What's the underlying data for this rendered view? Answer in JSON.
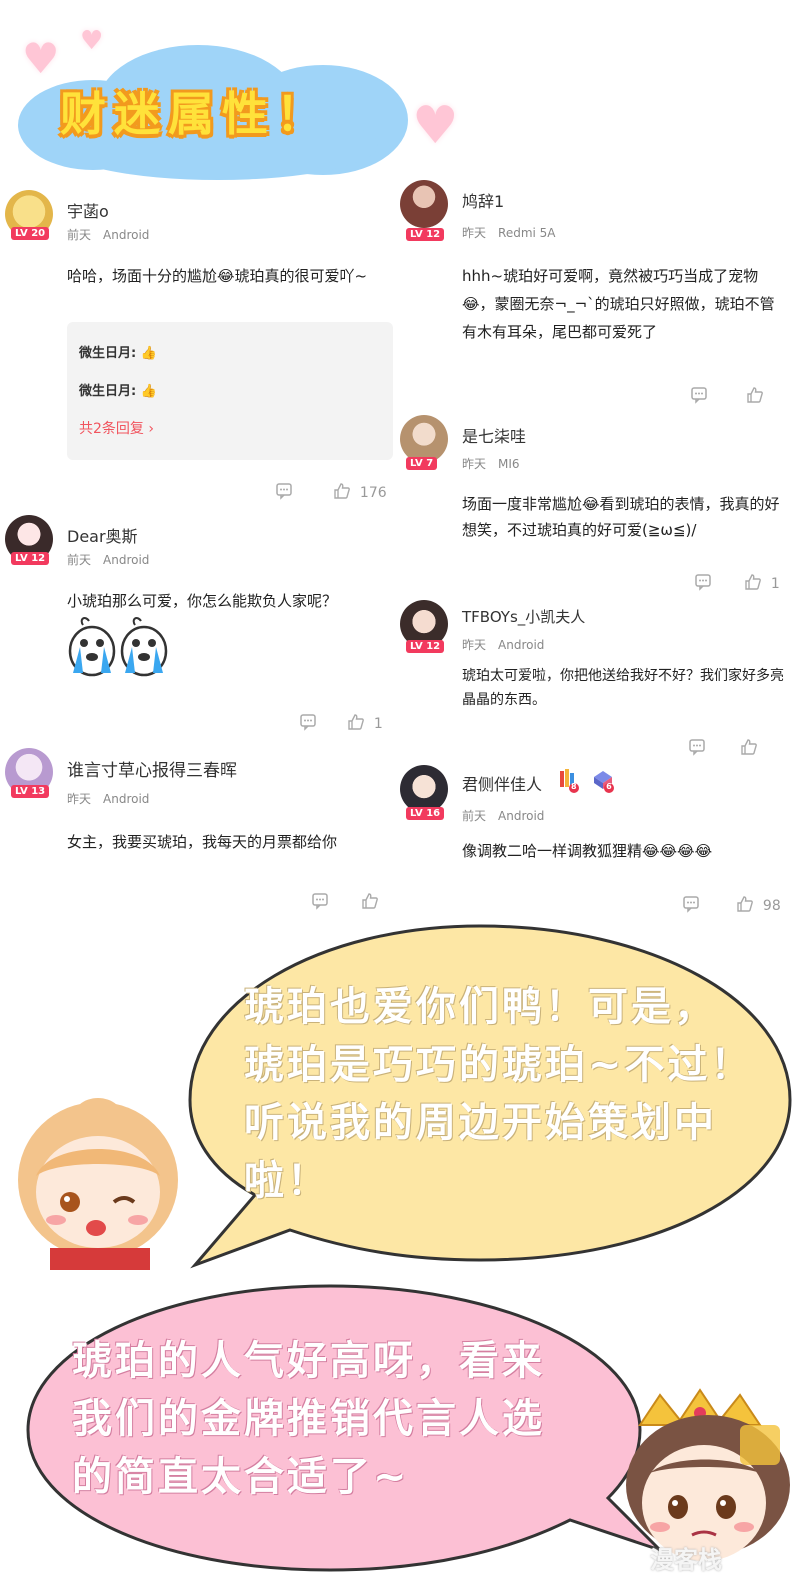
{
  "banner": {
    "title": "财迷属性！"
  },
  "comments_left": [
    {
      "level": "LV 20",
      "name": "宇菡o",
      "time": "前天",
      "device": "Android",
      "text": "哈哈，场面十分的尴尬😂琥珀真的很可爱吖~",
      "replies": [
        "微生日月:",
        "微生日月:"
      ],
      "reply_more": "共2条回复",
      "likes": "176"
    },
    {
      "level": "LV 12",
      "name": "Dear奥斯",
      "time": "前天",
      "device": "Android",
      "text": "小琥珀那么可爱，你怎么能欺负人家呢？",
      "likes": "1"
    },
    {
      "level": "LV 13",
      "name": "谁言寸草心报得三春晖",
      "time": "昨天",
      "device": "Android",
      "text": "女主，我要买琥珀，我每天的月票都给你",
      "likes": ""
    }
  ],
  "comments_right": [
    {
      "level": "LV 12",
      "name": "鸠辞1",
      "time": "昨天",
      "device": "Redmi 5A",
      "text": "hhh~琥珀好可爱啊，竟然被巧巧当成了宠物😂，蒙圈无奈¬_¬`的琥珀只好照做，琥珀不管有木有耳朵，尾巴都可爱死了",
      "likes": ""
    },
    {
      "level": "LV 7",
      "name": "是七柒哇",
      "time": "昨天",
      "device": "MI6",
      "text": "场面一度非常尴尬😂看到琥珀的表情，我真的好想笑，不过琥珀真的好可爱(≧ω≦)/",
      "likes": "1"
    },
    {
      "level": "LV 12",
      "name": "TFBOYs_小凯夫人",
      "time": "昨天",
      "device": "Android",
      "text": "琥珀太可爱啦，你把他送给我好不好？我们家好多亮晶晶的东西。",
      "likes": ""
    },
    {
      "level": "LV 16",
      "name": "君侧伴佳人",
      "time": "前天",
      "device": "Android",
      "badges": [
        "8",
        "6"
      ],
      "text": "像调教二哈一样调教狐狸精😂😂😂😂",
      "likes": "98"
    }
  ],
  "bubbles": {
    "yellow": [
      "琥珀也爱你们鸭！可是，",
      "琥珀是巧巧的琥珀~不过！",
      "听说我的周边开始策划中",
      "啦！"
    ],
    "pink": [
      "琥珀的人气好高呀，看来",
      "我们的金牌推销代言人选",
      "的简直太合适了~"
    ]
  },
  "colors": {
    "level_badge": "#f23a5e",
    "yellow_bubble": "#fde7a5",
    "pink_bubble": "#fcc0d4",
    "cloud": "#9fd4f8"
  },
  "watermark": "漫客栈"
}
